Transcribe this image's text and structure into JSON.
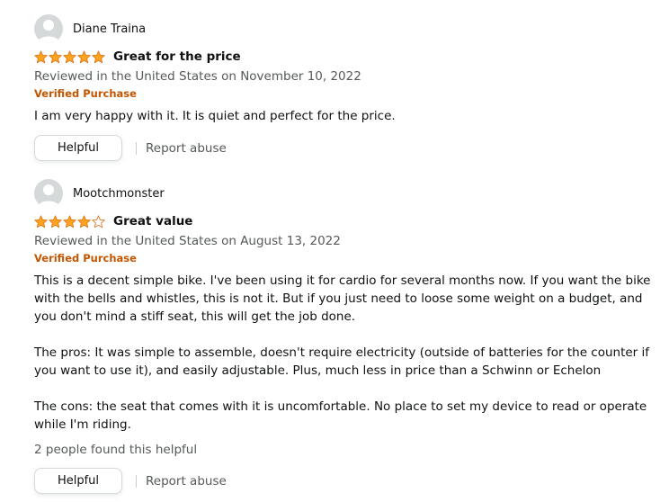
{
  "colors": {
    "star": "#ffa41c",
    "verified": "#c45500",
    "secondary_text": "#565959"
  },
  "reviews": [
    {
      "reviewer": "Diane Traina",
      "rating": 5,
      "title": "Great for the price",
      "date": "Reviewed in the United States on November 10, 2022",
      "verified": "Verified Purchase",
      "body": [
        "I am very happy with it. It is quiet and perfect for the price."
      ],
      "helpful_count": "",
      "helpful_label": "Helpful",
      "report_label": "Report abuse"
    },
    {
      "reviewer": "Mootchmonster",
      "rating": 4,
      "title": "Great value",
      "date": "Reviewed in the United States on August 13, 2022",
      "verified": "Verified Purchase",
      "body": [
        "This is a decent simple bike. I've been using it for cardio for several months now. If you want the bike with the bells and whistles, this is not it. But if you just need to loose some weight on a budget, and you don't mind a stiff seat, this will get the job done.",
        "The pros: It was simple to assemble, doesn't require electricity (outside of batteries for the counter if you want to use it), and easily adjustable. Plus, much less in price than a Schwinn or Echelon",
        "The cons: the seat that comes with it is uncomfortable. No place to set my device to read or operate while I'm riding."
      ],
      "helpful_count": "2 people found this helpful",
      "helpful_label": "Helpful",
      "report_label": "Report abuse"
    }
  ]
}
